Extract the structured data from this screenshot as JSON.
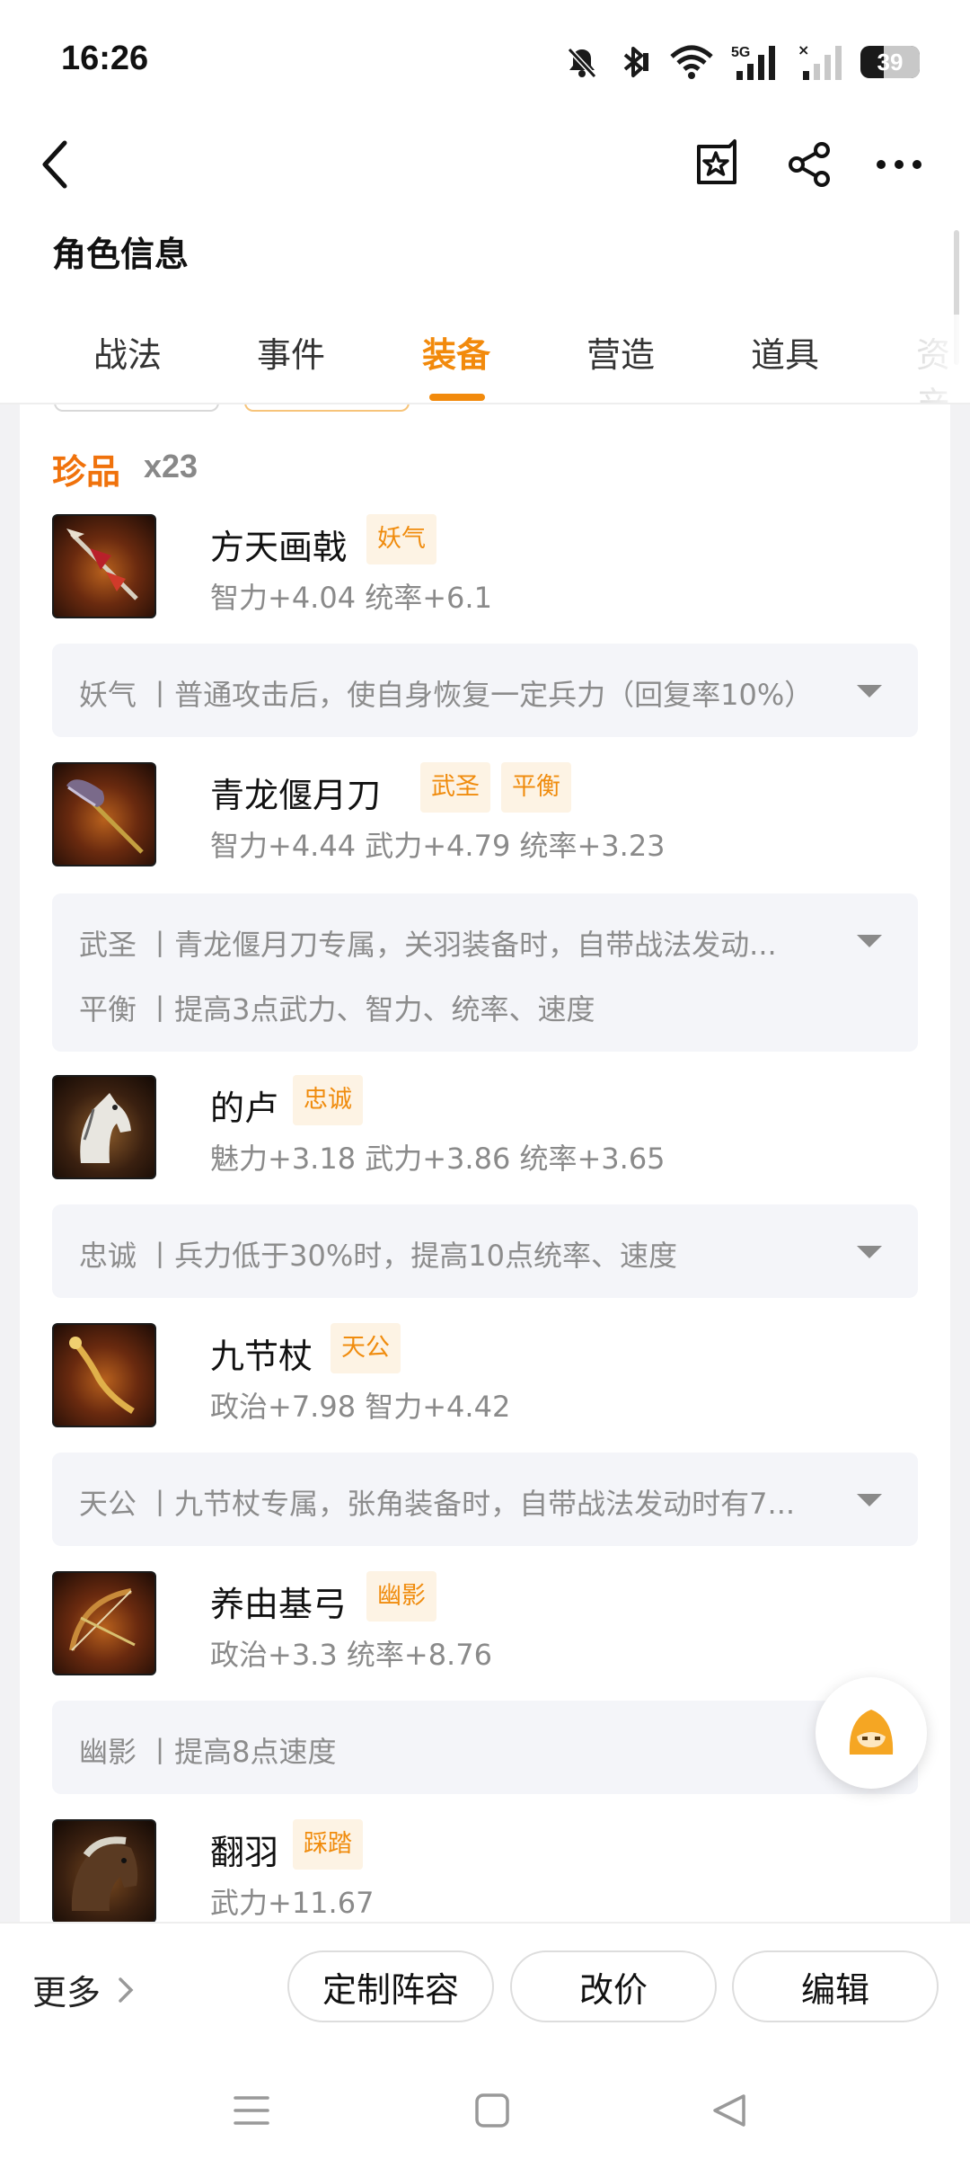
{
  "status_bar": {
    "time": "16:26",
    "battery": "39",
    "network": "5G"
  },
  "header": {
    "title": "角色信息"
  },
  "tabs": [
    {
      "label": "战法"
    },
    {
      "label": "事件"
    },
    {
      "label": "装备"
    },
    {
      "label": "营造"
    },
    {
      "label": "道具"
    },
    {
      "label": "资产"
    }
  ],
  "active_tab": "装备",
  "section": {
    "title": "珍品",
    "count": "x23"
  },
  "items": [
    {
      "name": "方天画戟",
      "tags": [
        "妖气"
      ],
      "stats": "智力+4.04 统率+6.1",
      "desc": [
        "妖气 丨普通攻击后，使自身恢复一定兵力（回复率10%）"
      ]
    },
    {
      "name": "青龙偃月刀",
      "tags": [
        "武圣",
        "平衡"
      ],
      "stats": "智力+4.44 武力+4.79 统率+3.23",
      "desc": [
        "武圣 丨青龙偃月刀专属，关羽装备时，自带战法发动...",
        "平衡 丨提高3点武力、智力、统率、速度"
      ]
    },
    {
      "name": "的卢",
      "tags": [
        "忠诚"
      ],
      "stats": "魅力+3.18 武力+3.86 统率+3.65",
      "desc": [
        "忠诚 丨兵力低于30%时，提高10点统率、速度"
      ]
    },
    {
      "name": "九节杖",
      "tags": [
        "天公"
      ],
      "stats": "政治+7.98 智力+4.42",
      "desc": [
        "天公 丨九节杖专属，张角装备时，自带战法发动时有7..."
      ]
    },
    {
      "name": "养由基弓",
      "tags": [
        "幽影"
      ],
      "stats": "政治+3.3 统率+8.76",
      "desc": [
        "幽影 丨提高8点速度"
      ]
    },
    {
      "name": "翻羽",
      "tags": [
        "踩踏"
      ],
      "stats": "武力+11.67",
      "desc": []
    }
  ],
  "bottom": {
    "more_label": "更多",
    "buttons": [
      "定制阵容",
      "改价",
      "编辑"
    ]
  },
  "icons": {
    "back": "chevron-left-icon",
    "favorite": "star-bookmark-icon",
    "share": "share-icon",
    "more": "more-dots-icon",
    "assistant": "assistant-mascot-icon"
  },
  "colors": {
    "accent": "#f28a0c",
    "tag_bg": "#fdf3e4",
    "desc_bg": "#f4f5f9"
  }
}
